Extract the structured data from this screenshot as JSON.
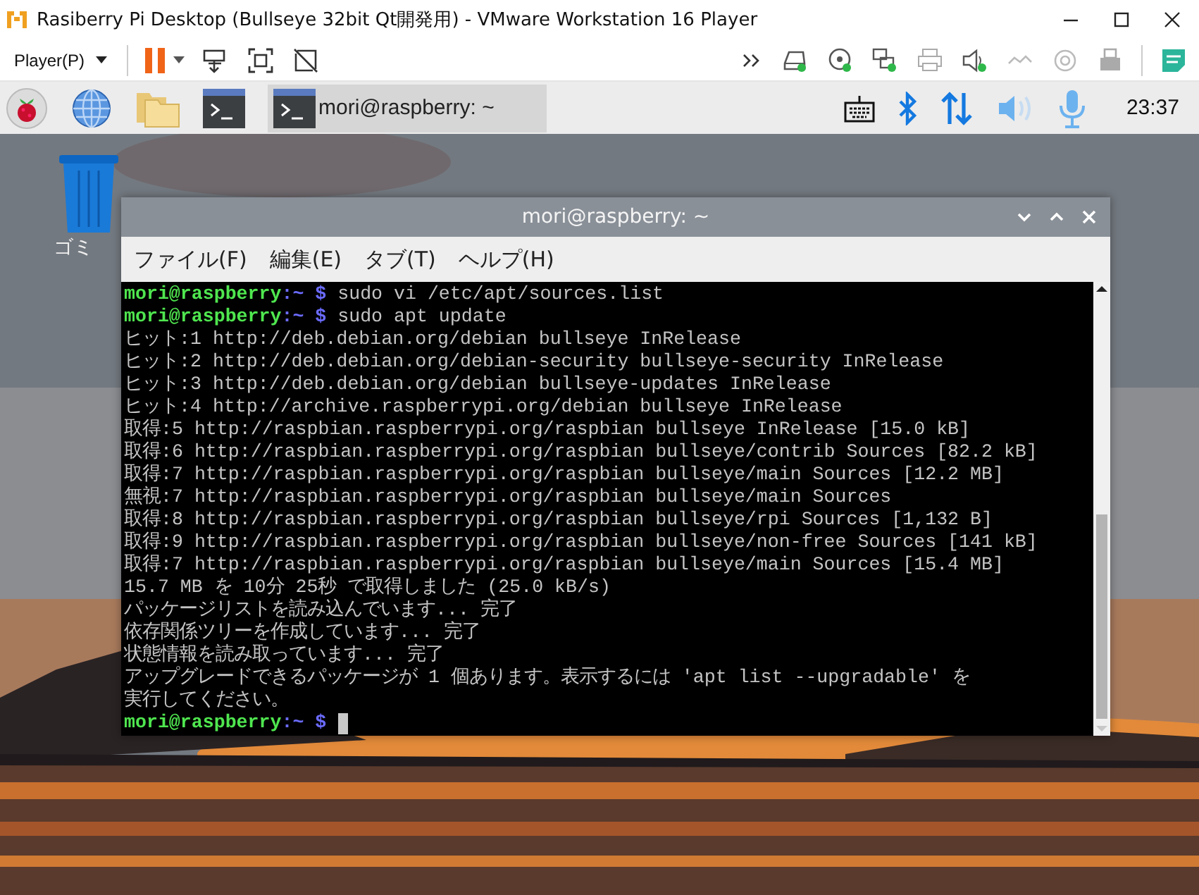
{
  "vmware": {
    "title": "Rasiberry Pi Desktop (Bullseye 32bit Qt開発用) - VMware Workstation 16 Player",
    "menu": "Player(P)"
  },
  "taskbar": {
    "task": "mori@raspberry: ~",
    "clock": "23:37"
  },
  "desktop_icons": [
    {
      "label": "ゴミ"
    }
  ],
  "terminal": {
    "title": "mori@raspberry: ~",
    "menu": [
      "ファイル(F)",
      "編集(E)",
      "タブ(T)",
      "ヘルプ(H)"
    ],
    "lines": [
      {
        "kind": "prompt",
        "user": "mori@raspberry",
        "path": ":~ $",
        "command": "sudo vi /etc/apt/sources.list"
      },
      {
        "kind": "prompt",
        "user": "mori@raspberry",
        "path": ":~ $",
        "command": "sudo apt update"
      },
      {
        "kind": "output",
        "text": "ヒット:1 http://deb.debian.org/debian bullseye InRelease"
      },
      {
        "kind": "output",
        "text": "ヒット:2 http://deb.debian.org/debian-security bullseye-security InRelease"
      },
      {
        "kind": "output",
        "text": "ヒット:3 http://deb.debian.org/debian bullseye-updates InRelease"
      },
      {
        "kind": "output",
        "text": "ヒット:4 http://archive.raspberrypi.org/debian bullseye InRelease"
      },
      {
        "kind": "output",
        "text": "取得:5 http://raspbian.raspberrypi.org/raspbian bullseye InRelease [15.0 kB]"
      },
      {
        "kind": "output",
        "text": "取得:6 http://raspbian.raspberrypi.org/raspbian bullseye/contrib Sources [82.2 kB]"
      },
      {
        "kind": "output",
        "text": "取得:7 http://raspbian.raspberrypi.org/raspbian bullseye/main Sources [12.2 MB]"
      },
      {
        "kind": "output",
        "text": "無視:7 http://raspbian.raspberrypi.org/raspbian bullseye/main Sources"
      },
      {
        "kind": "output",
        "text": "取得:8 http://raspbian.raspberrypi.org/raspbian bullseye/rpi Sources [1,132 B]"
      },
      {
        "kind": "output",
        "text": "取得:9 http://raspbian.raspberrypi.org/raspbian bullseye/non-free Sources [141 kB]"
      },
      {
        "kind": "output",
        "text": "取得:7 http://raspbian.raspberrypi.org/raspbian bullseye/main Sources [15.4 MB]"
      },
      {
        "kind": "output",
        "text": "15.7 MB を 10分 25秒 で取得しました (25.0 kB/s)"
      },
      {
        "kind": "output",
        "text": "パッケージリストを読み込んでいます... 完了"
      },
      {
        "kind": "output",
        "text": "依存関係ツリーを作成しています... 完了"
      },
      {
        "kind": "output",
        "text": "状態情報を読み取っています... 完了"
      },
      {
        "kind": "output",
        "text": "アップグレードできるパッケージが 1 個あります。表示するには 'apt list --upgradable' を"
      },
      {
        "kind": "output",
        "text": "実行してください。"
      },
      {
        "kind": "prompt",
        "user": "mori@raspberry",
        "path": ":~ $"
      }
    ]
  }
}
